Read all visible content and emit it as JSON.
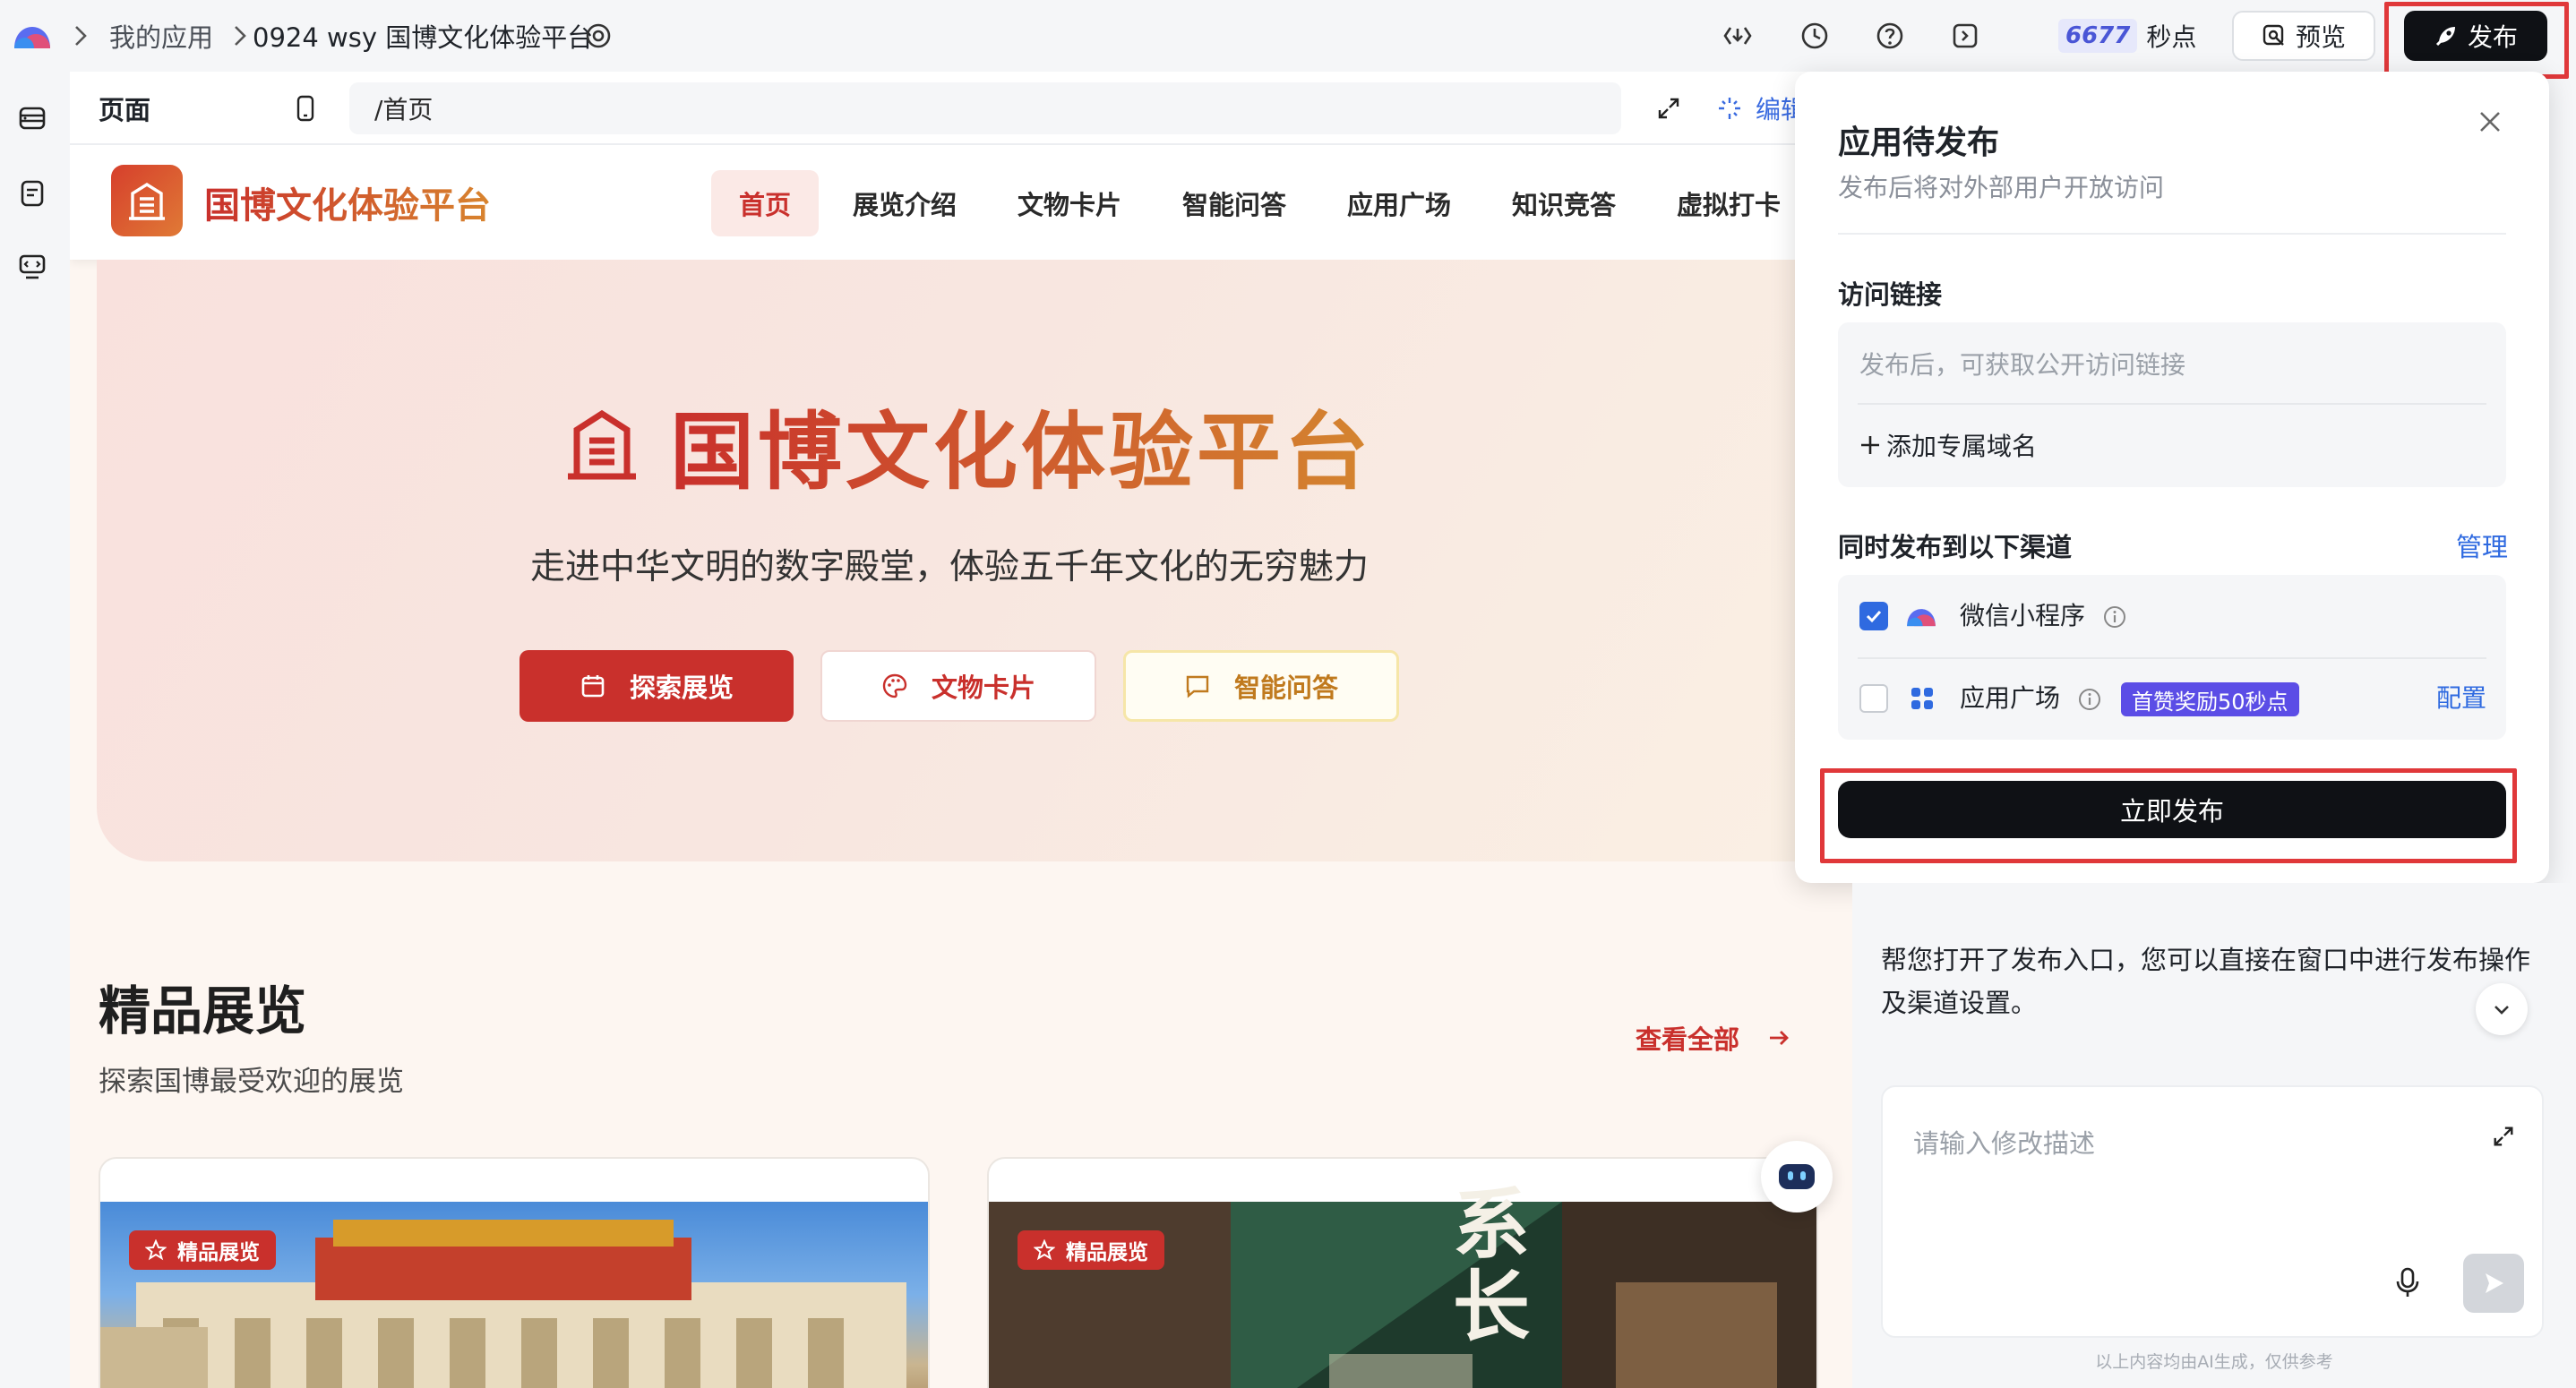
{
  "topbar": {
    "breadcrumb_root": "我的应用",
    "app_name": "0924 wsy 国博文化体验平台",
    "points_value": "6677",
    "points_unit": "秒点",
    "preview_label": "预览",
    "publish_label": "发布"
  },
  "pagebar": {
    "label": "页面",
    "path": "/首页",
    "edit_label": "编辑"
  },
  "site": {
    "brand": "国博文化体验平台",
    "nav": [
      "首页",
      "展览介绍",
      "文物卡片",
      "智能问答",
      "应用广场",
      "知识竞答",
      "虚拟打卡"
    ],
    "hero_title": "国博文化体验平台",
    "hero_subtitle": "走进中华文明的数字殿堂，体验五千年文化的无穷魅力",
    "hero_buttons": [
      "探索展览",
      "文物卡片",
      "智能问答"
    ],
    "section_title": "精品展览",
    "section_subtitle": "探索国博最受欢迎的展览",
    "view_all": "查看全部",
    "card_tag": "精品展览",
    "card2_sign_text": "系长"
  },
  "publish_panel": {
    "title": "应用待发布",
    "subtitle": "发布后将对外部用户开放访问",
    "access_link_label": "访问链接",
    "access_link_placeholder": "发布后，可获取公开访问链接",
    "add_domain": "添加专属域名",
    "channels_label": "同时发布到以下渠道",
    "manage": "管理",
    "channels": [
      {
        "name": "微信小程序",
        "checked": true
      },
      {
        "name": "应用广场",
        "checked": false,
        "badge": "首赞奖励50秒点",
        "action": "配置"
      }
    ],
    "publish_now": "立即发布"
  },
  "chat": {
    "message": "帮您打开了发布入口，您可以直接在窗口中进行发布操作及渠道设置。",
    "input_placeholder": "请输入修改描述",
    "disclaimer": "以上内容均由AI生成，仅供参考"
  },
  "colors": {
    "brand_red": "#c9302c",
    "brand_orange": "#c8742a",
    "link_blue": "#2f6ae0",
    "badge_purple": "#5b4de6",
    "dark": "#0f1115",
    "highlight_red": "#e0383a"
  }
}
